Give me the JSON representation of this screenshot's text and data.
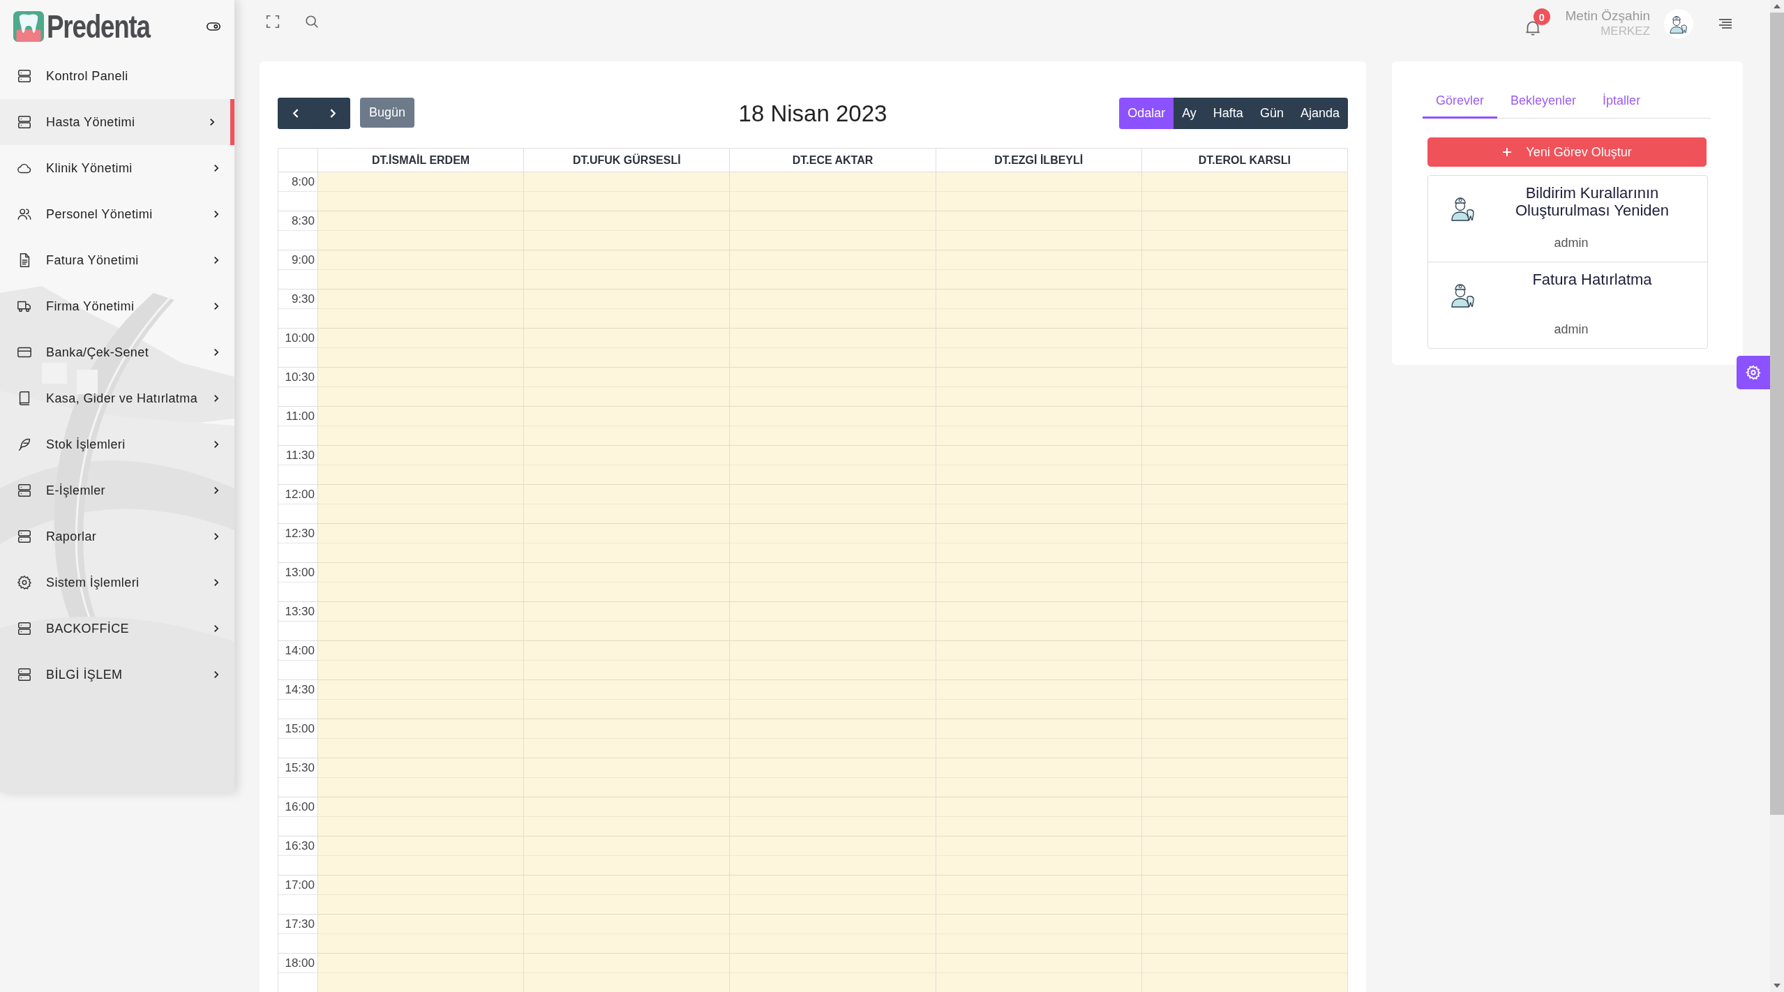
{
  "brand": {
    "name": "Predenta"
  },
  "sidebar": {
    "items": [
      {
        "label": "Kontrol Paneli",
        "has_submenu": false,
        "selected": false
      },
      {
        "label": "Hasta Yönetimi",
        "has_submenu": true,
        "selected": true
      },
      {
        "label": "Klinik Yönetimi",
        "has_submenu": true,
        "selected": false
      },
      {
        "label": "Personel Yönetimi",
        "has_submenu": true,
        "selected": false
      },
      {
        "label": "Fatura Yönetimi",
        "has_submenu": true,
        "selected": false
      },
      {
        "label": "Firma Yönetimi",
        "has_submenu": true,
        "selected": false
      },
      {
        "label": "Banka/Çek-Senet",
        "has_submenu": true,
        "selected": false
      },
      {
        "label": "Kasa, Gider ve Hatırlatma",
        "has_submenu": true,
        "selected": false
      },
      {
        "label": "Stok İşlemleri",
        "has_submenu": true,
        "selected": false
      },
      {
        "label": "E-İşlemler",
        "has_submenu": true,
        "selected": false
      },
      {
        "label": "Raporlar",
        "has_submenu": true,
        "selected": false
      },
      {
        "label": "Sistem İşlemleri",
        "has_submenu": true,
        "selected": false
      },
      {
        "label": "BACKOFFİCE",
        "has_submenu": true,
        "selected": false
      },
      {
        "label": "BİLGİ İŞLEM",
        "has_submenu": true,
        "selected": false
      }
    ]
  },
  "header": {
    "notification_count": "0",
    "user_name": "Metin Özşahin",
    "user_branch": "MERKEZ"
  },
  "calendar": {
    "title": "18 Nisan 2023",
    "today_button": "Bugün",
    "views": [
      {
        "label": "Odalar",
        "selected": true
      },
      {
        "label": "Ay",
        "selected": false
      },
      {
        "label": "Hafta",
        "selected": false
      },
      {
        "label": "Gün",
        "selected": false
      },
      {
        "label": "Ajanda",
        "selected": false
      }
    ],
    "columns": [
      "DT.İSMAİL ERDEM",
      "DT.UFUK GÜRSESLİ",
      "DT.ECE AKTAR",
      "DT.EZGİ İLBEYLİ",
      "DT.EROL KARSLI"
    ],
    "times": [
      "8:00",
      "8:30",
      "9:00",
      "9:30",
      "10:00",
      "10:30",
      "11:00",
      "11:30",
      "12:00",
      "12:30",
      "13:00",
      "13:30",
      "14:00",
      "14:30",
      "15:00",
      "15:30",
      "16:00",
      "16:30",
      "17:00",
      "17:30",
      "18:00"
    ]
  },
  "tasks_panel": {
    "tabs": [
      {
        "label": "Görevler",
        "selected": true
      },
      {
        "label": "Bekleyenler",
        "selected": false
      },
      {
        "label": "İptaller",
        "selected": false
      }
    ],
    "new_task_button": "Yeni Görev Oluştur",
    "tasks": [
      {
        "title": "Bildirim Kurallarının Oluşturulması Yeniden",
        "owner": "admin"
      },
      {
        "title": "Fatura Hatırlatma",
        "owner": "admin"
      }
    ]
  }
}
